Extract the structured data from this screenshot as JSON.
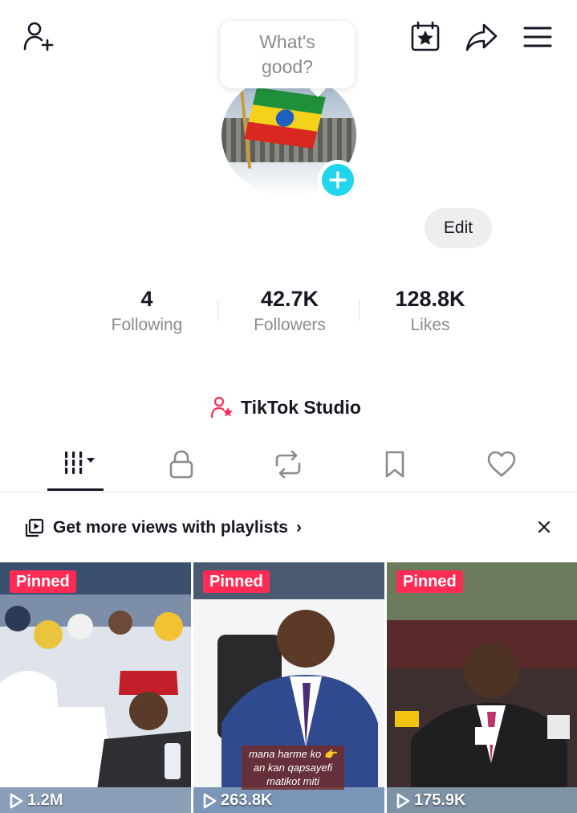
{
  "header": {
    "add_friend_icon": "person-plus-icon",
    "calendar_icon": "calendar-star-icon",
    "share_icon": "share-arrow-icon",
    "menu_icon": "hamburger-menu-icon"
  },
  "profile": {
    "prompt_bubble": "What's good?",
    "edit_label": "Edit"
  },
  "stats": [
    {
      "value": "4",
      "label": "Following"
    },
    {
      "value": "42.7K",
      "label": "Followers"
    },
    {
      "value": "128.8K",
      "label": "Likes"
    }
  ],
  "studio": {
    "label": "TikTok Studio"
  },
  "tabs": [
    {
      "icon": "grid-videos-icon",
      "selected": true
    },
    {
      "icon": "lock-icon"
    },
    {
      "icon": "repost-icon"
    },
    {
      "icon": "bookmark-icon"
    },
    {
      "icon": "heart-icon"
    }
  ],
  "promo": {
    "label": "Get more views with playlists",
    "chevron": "›",
    "close": "×"
  },
  "videos": [
    {
      "badge": "Pinned",
      "views": "1.2M"
    },
    {
      "badge": "Pinned",
      "views": "263.8K",
      "caption": "mana harme ko 👉 an kan qapsayefi matikot miti"
    },
    {
      "badge": "Pinned",
      "views": "175.9K"
    }
  ],
  "colors": {
    "accent": "#fe2c55",
    "plus": "#20d5ec",
    "text": "#161823",
    "muted": "#8a8b91"
  }
}
